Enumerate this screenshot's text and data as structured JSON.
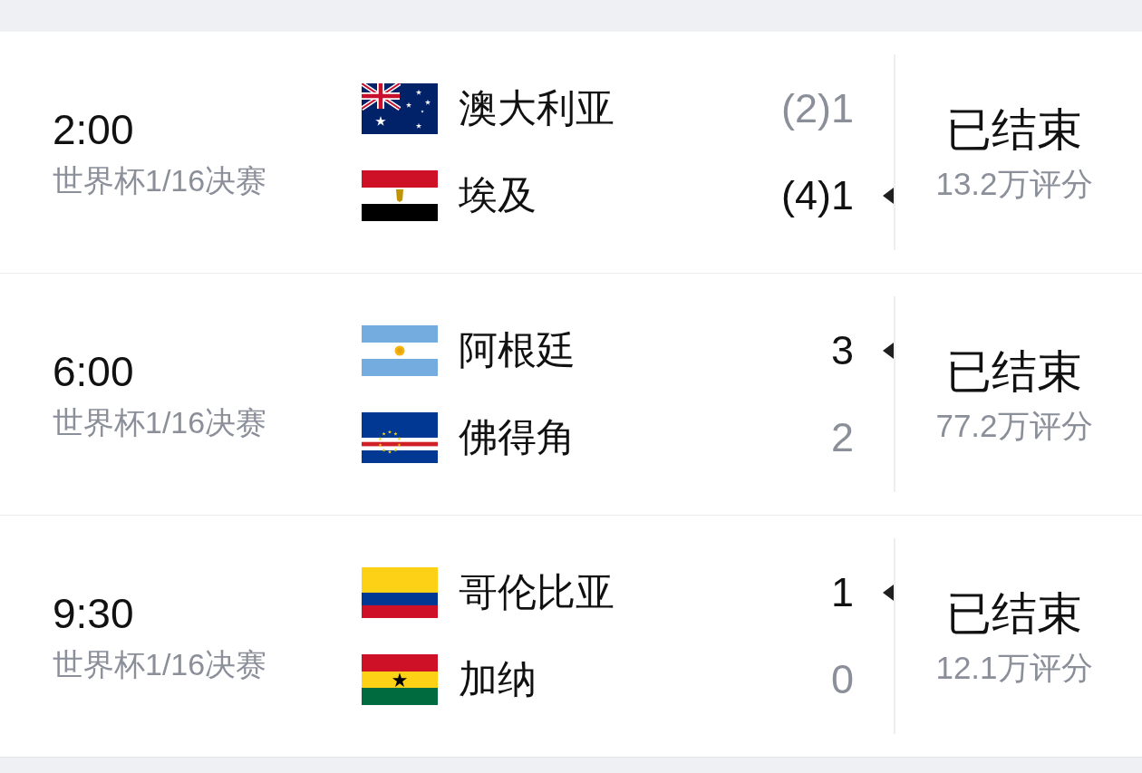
{
  "matches": [
    {
      "time": "2:00",
      "league": "世界杯1/16决赛",
      "teams": [
        {
          "name": "澳大利亚",
          "score": "(2)1",
          "winner": false
        },
        {
          "name": "埃及",
          "score": "(4)1",
          "winner": true
        }
      ],
      "status": "已结束",
      "rating": "13.2万评分"
    },
    {
      "time": "6:00",
      "league": "世界杯1/16决赛",
      "teams": [
        {
          "name": "阿根廷",
          "score": "3",
          "winner": true
        },
        {
          "name": "佛得角",
          "score": "2",
          "winner": false
        }
      ],
      "status": "已结束",
      "rating": "77.2万评分"
    },
    {
      "time": "9:30",
      "league": "世界杯1/16决赛",
      "teams": [
        {
          "name": "哥伦比亚",
          "score": "1",
          "winner": true
        },
        {
          "name": "加纳",
          "score": "0",
          "winner": false
        }
      ],
      "status": "已结束",
      "rating": "12.1万评分"
    }
  ]
}
